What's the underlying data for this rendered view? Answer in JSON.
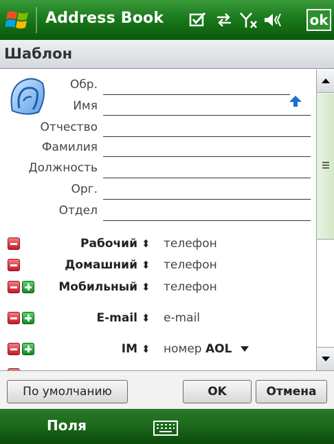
{
  "titlebar": {
    "app_title": "Address Book",
    "ok_label": "ok",
    "status_icons": [
      "messaging-icon",
      "connectivity-icon",
      "signal-icon",
      "volume-icon"
    ]
  },
  "header": {
    "title": "Шаблон"
  },
  "name_fields": [
    {
      "label": "Обр."
    },
    {
      "label": "Имя"
    },
    {
      "label": "Отчество"
    },
    {
      "label": "Фамилия"
    },
    {
      "label": "Должность"
    },
    {
      "label": "Орг."
    },
    {
      "label": "Отдел"
    }
  ],
  "detail_rows": [
    {
      "label": "Рабочий",
      "value": "телефон",
      "removable": true,
      "addable": false
    },
    {
      "label": "Домашний",
      "value": "телефон",
      "removable": true,
      "addable": false
    },
    {
      "label": "Мобильный",
      "value": "телефон",
      "removable": true,
      "addable": true
    },
    {
      "label": "E-mail",
      "value": "e-mail",
      "removable": true,
      "addable": true
    },
    {
      "label": "IM",
      "value_prefix": "номер",
      "value_bold": "AOL",
      "removable": true,
      "addable": true
    }
  ],
  "sort_glyph": "⬍",
  "buttons": {
    "default_label": "По умолчанию",
    "ok_label": "OK",
    "cancel_label": "Отмена"
  },
  "softkeys": {
    "left_label": "Поля"
  },
  "colors": {
    "title_green": "#1b7a1b",
    "minus_red": "#c8182a",
    "plus_green": "#158a26",
    "arrow_blue": "#1a6fd4"
  }
}
